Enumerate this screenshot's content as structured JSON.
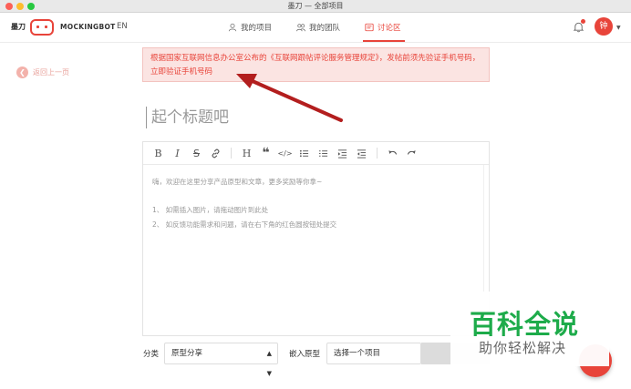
{
  "window": {
    "title": "墨刀 — 全部项目"
  },
  "header": {
    "brand_cn": "墨刀",
    "brand_name": "MOCKINGBOT",
    "lang": "EN",
    "nav": [
      {
        "label": "我的项目",
        "icon": "user-icon"
      },
      {
        "label": "我的团队",
        "icon": "team-icon"
      },
      {
        "label": "讨论区",
        "icon": "discussion-icon"
      }
    ],
    "avatar_text": "钟",
    "accent_color": "#e8443a"
  },
  "back": {
    "label": "返回上一页"
  },
  "alert": {
    "text": "根据国家互联网信息办公室公布的《互联网跟帖评论服务管理规定》，发帖前须先验证手机号码，立即验证手机号码"
  },
  "post": {
    "title_placeholder": "起个标题吧",
    "editor_lines": [
      "嗨，欢迎在这里分享产品原型和文章，更多奖励等你拿~",
      "1、 如需插入图片，请拖动图片到此处",
      "2、 如反馈功能需求和问题，请在右下角的红色圆按钮处提交"
    ],
    "toolbar": [
      "B",
      "I",
      "S",
      "link",
      "H",
      "quote",
      "code",
      "ul",
      "ol",
      "indent",
      "outdent",
      "undo",
      "redo"
    ]
  },
  "footer": {
    "category_label": "分类",
    "category_value": "原型分享",
    "embed_label": "嵌入原型",
    "embed_value": "选择一个项目"
  },
  "watermark": {
    "big": "百科全说",
    "small": "助你轻松解决",
    "color": "#1dab4a"
  }
}
